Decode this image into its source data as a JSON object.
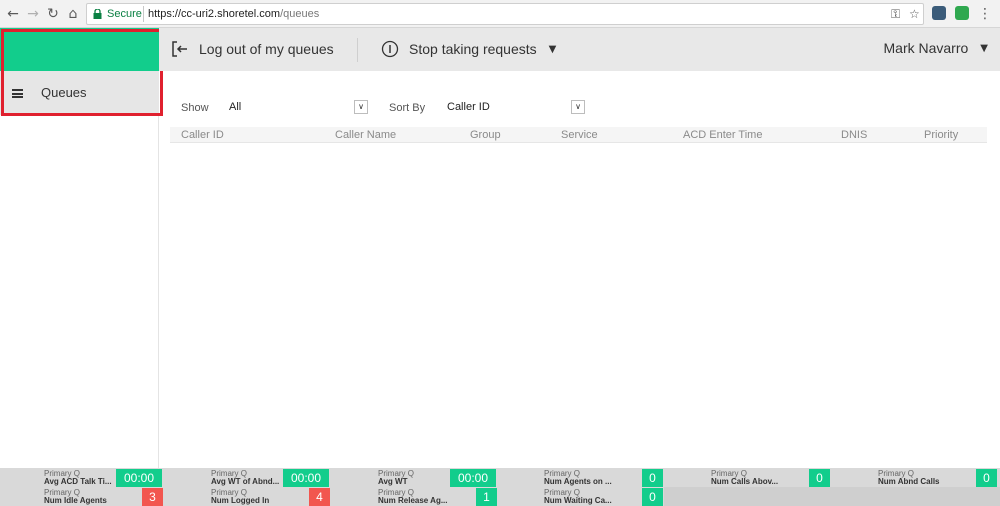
{
  "browser": {
    "secure_label": "Secure",
    "url_host": "https://cc-uri2.shoretel.com",
    "url_path": "/queues"
  },
  "sidebar": {
    "queues_label": "Queues"
  },
  "topbar": {
    "logout_label": "Log out of my queues",
    "stop_label": "Stop taking requests",
    "user_name": "Mark Navarro"
  },
  "filters": {
    "show_label": "Show",
    "show_value": "All",
    "sortby_label": "Sort By",
    "sortby_value": "Caller ID"
  },
  "table": {
    "headers": [
      "Caller ID",
      "Caller Name",
      "Group",
      "Service",
      "ACD Enter Time",
      "DNIS",
      "Priority"
    ]
  },
  "stats": {
    "row1": [
      {
        "title": "Primary Q",
        "name": "Avg ACD Talk Ti...",
        "value": "00:00",
        "color": "green"
      },
      {
        "title": "Primary Q",
        "name": "Avg WT of Abnd...",
        "value": "00:00",
        "color": "green"
      },
      {
        "title": "Primary Q",
        "name": "Avg WT",
        "value": "00:00",
        "color": "green"
      },
      {
        "title": "Primary Q",
        "name": "Num Agents on ...",
        "value": "0",
        "color": "green"
      },
      {
        "title": "Primary Q",
        "name": "Num Calls Abov...",
        "value": "0",
        "color": "green"
      },
      {
        "title": "Primary Q",
        "name": "Num Abnd Calls",
        "value": "0",
        "color": "green"
      }
    ],
    "row2": [
      {
        "title": "Primary Q",
        "name": "Num Idle Agents",
        "value": "3",
        "color": "red"
      },
      {
        "title": "Primary Q",
        "name": "Num Logged In",
        "value": "4",
        "color": "red"
      },
      {
        "title": "Primary Q",
        "name": "Num Release Ag...",
        "value": "1",
        "color": "green"
      },
      {
        "title": "Primary Q",
        "name": "Num Waiting Ca...",
        "value": "0",
        "color": "green"
      }
    ]
  },
  "colors": {
    "accent_green": "#12cd8c",
    "alert_red": "#f2564f",
    "highlight_red": "#e0202e"
  }
}
